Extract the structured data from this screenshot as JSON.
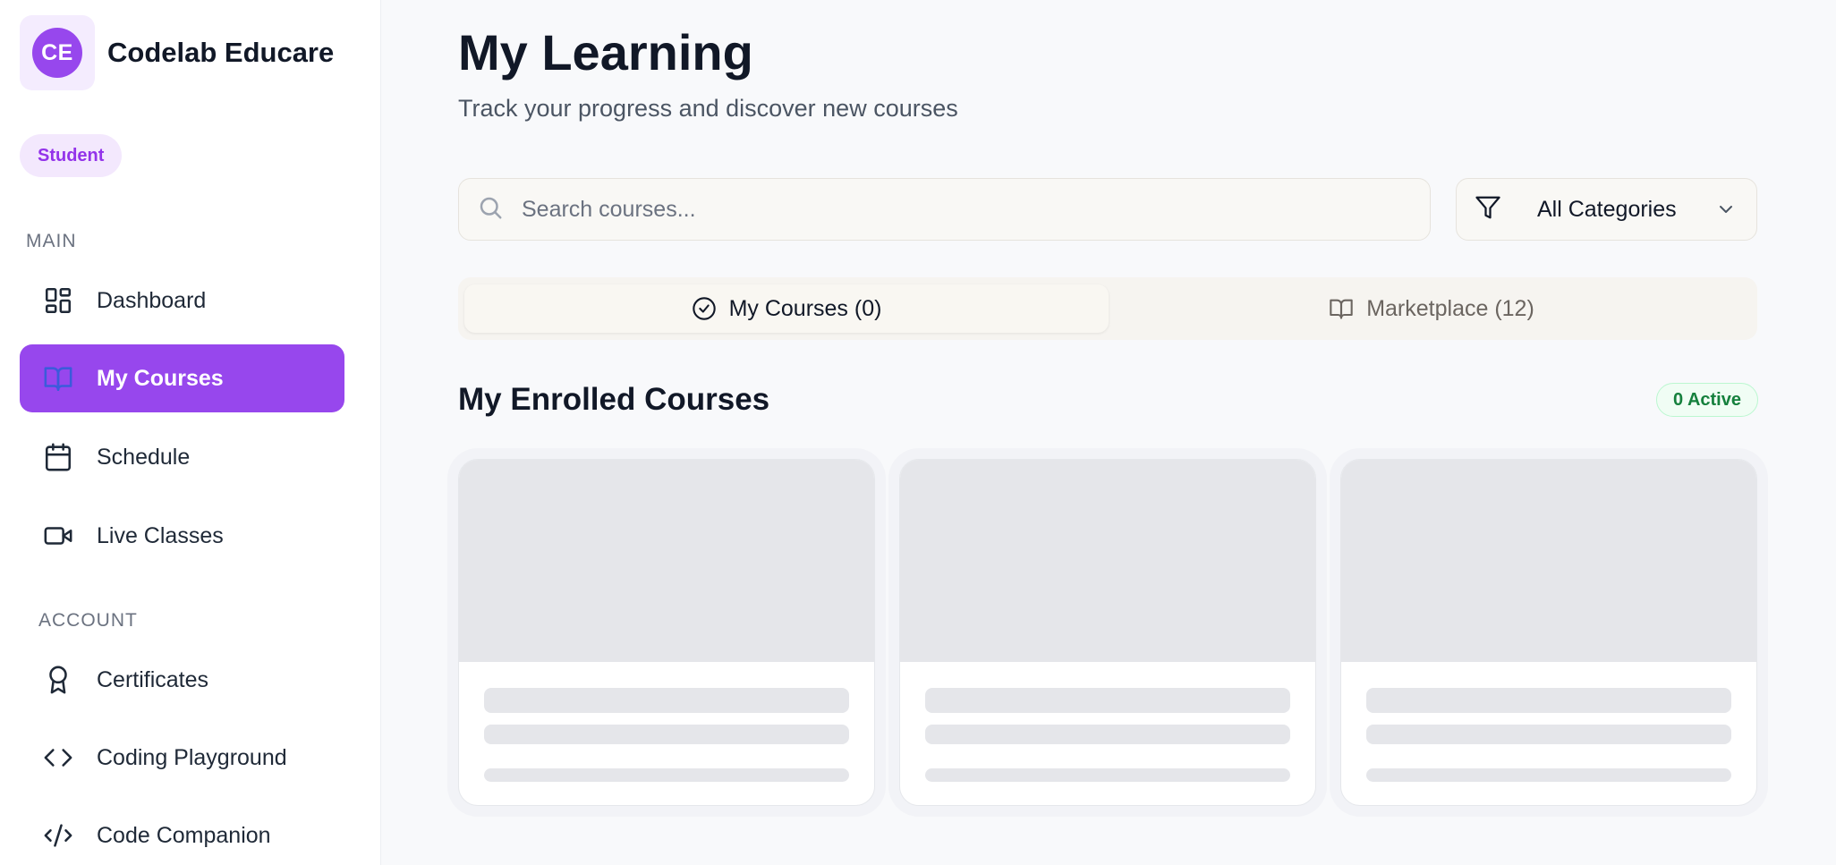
{
  "brand": {
    "initials": "CE",
    "name": "Codelab Educare"
  },
  "role": "Student",
  "sidebar": {
    "main_label": "MAIN",
    "account_label": "ACCOUNT",
    "main_items": [
      {
        "label": "Dashboard",
        "icon": "dashboard-icon",
        "active": false
      },
      {
        "label": "My Courses",
        "icon": "book-open-icon",
        "active": true
      },
      {
        "label": "Schedule",
        "icon": "calendar-icon",
        "active": false
      },
      {
        "label": "Live Classes",
        "icon": "video-icon",
        "active": false
      }
    ],
    "account_items": [
      {
        "label": "Certificates",
        "icon": "award-icon"
      },
      {
        "label": "Coding Playground",
        "icon": "code-brackets-icon"
      },
      {
        "label": "Code Companion",
        "icon": "code-slash-icon"
      }
    ]
  },
  "header": {
    "title": "My Learning",
    "subtitle": "Track your progress and discover new courses"
  },
  "search": {
    "placeholder": "Search courses...",
    "value": ""
  },
  "category_filter": {
    "selected": "All Categories"
  },
  "tabs": [
    {
      "label": "My Courses (0)",
      "icon": "check-circle-icon",
      "active": true
    },
    {
      "label": "Marketplace (12)",
      "icon": "book-open-icon",
      "active": false
    }
  ],
  "enrolled": {
    "heading": "My Enrolled Courses",
    "badge": "0 Active",
    "skeleton_cards": 3
  },
  "colors": {
    "accent": "#9747ed",
    "accent_soft": "#f3e8fd",
    "badge_green": "#15803d",
    "skeleton": "#e5e6ea"
  }
}
